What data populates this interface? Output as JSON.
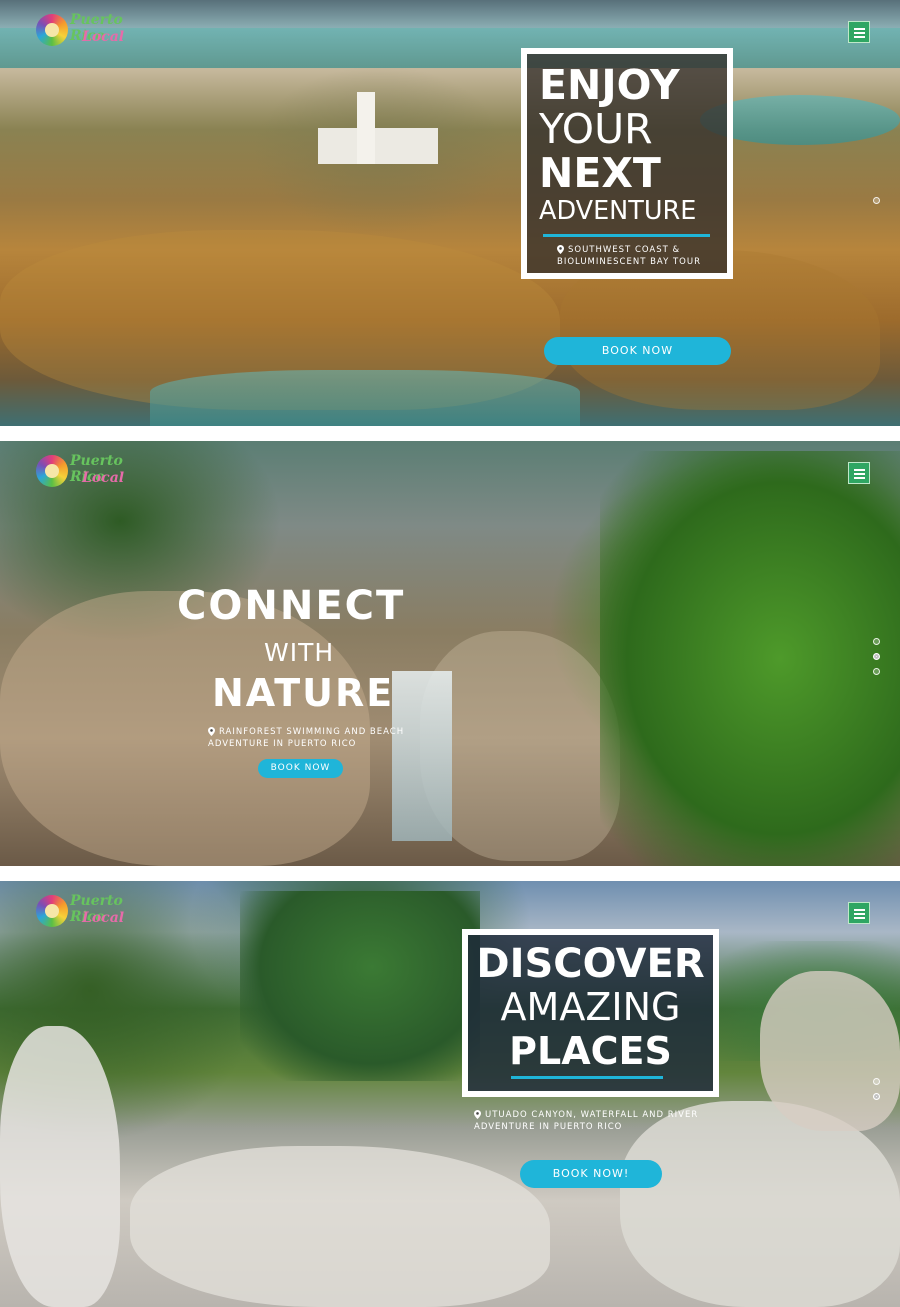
{
  "brand": {
    "logo_line1": "Puerto Rico",
    "logo_line2": "Local",
    "accent": "#1fb5d9",
    "menu_color": "#2fa663"
  },
  "icons": {
    "menu": "hamburger-icon",
    "location": "map-pin-icon",
    "slider_dot": "circle-dot-icon"
  },
  "slides": [
    {
      "headline": [
        "ENJOY",
        "YOUR",
        "NEXT",
        "ADVENTURE"
      ],
      "location": [
        "SOUTHWEST COAST &",
        "BIOLUMINESCENT BAY TOUR"
      ],
      "cta": "BOOK NOW"
    },
    {
      "headline": [
        "CONNECT",
        "WITH",
        "NATURE"
      ],
      "location": [
        "RAINFOREST SWIMMING AND BEACH",
        "ADVENTURE IN PUERTO RICO"
      ],
      "cta": "BOOK NOW"
    },
    {
      "headline": [
        "DISCOVER",
        "AMAZING",
        "PLACES"
      ],
      "location": [
        "UTUADO CANYON, WATERFALL AND RIVER",
        "ADVENTURE IN PUERTO RICO"
      ],
      "cta": "BOOK NOW!"
    }
  ]
}
